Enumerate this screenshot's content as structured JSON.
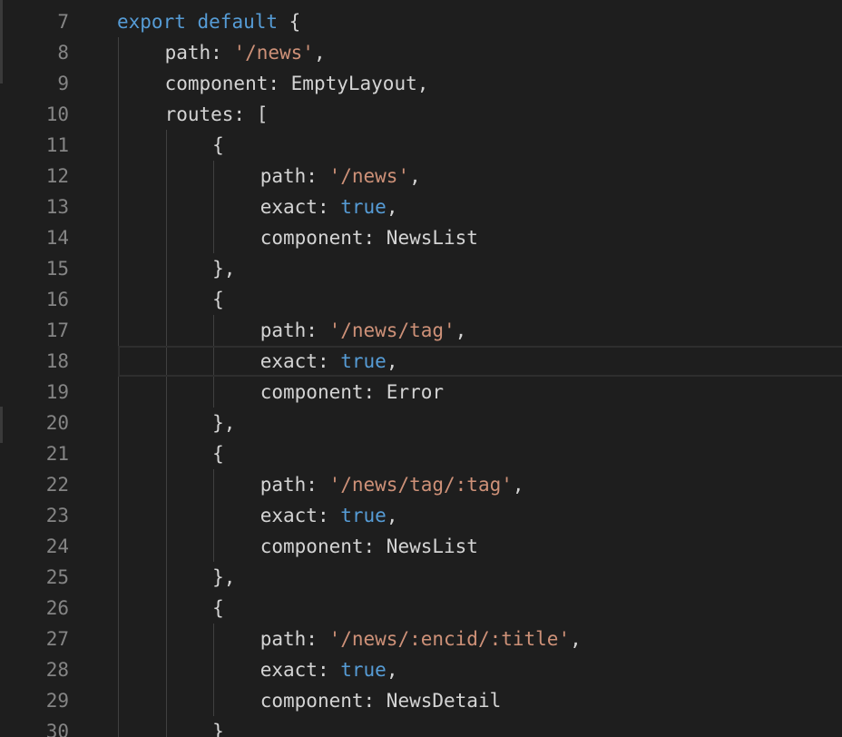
{
  "editor": {
    "colors": {
      "background": "#1e1e1e",
      "line_number": "#858585",
      "keyword": "#569cd6",
      "string": "#ce9178",
      "text": "#d4d4d4"
    },
    "current_line": "18",
    "lines": [
      {
        "n": "7",
        "indent": 0,
        "tokens": [
          {
            "t": "kw",
            "v": "export"
          },
          {
            "t": "plain",
            "v": " "
          },
          {
            "t": "kw",
            "v": "default"
          },
          {
            "t": "plain",
            "v": " {"
          }
        ]
      },
      {
        "n": "8",
        "indent": 1,
        "tokens": [
          {
            "t": "plain",
            "v": "path: "
          },
          {
            "t": "str",
            "v": "'/news'"
          },
          {
            "t": "plain",
            "v": ","
          }
        ]
      },
      {
        "n": "9",
        "indent": 1,
        "tokens": [
          {
            "t": "plain",
            "v": "component: EmptyLayout,"
          }
        ]
      },
      {
        "n": "10",
        "indent": 1,
        "tokens": [
          {
            "t": "plain",
            "v": "routes: ["
          }
        ]
      },
      {
        "n": "11",
        "indent": 2,
        "tokens": [
          {
            "t": "plain",
            "v": "{"
          }
        ]
      },
      {
        "n": "12",
        "indent": 3,
        "tokens": [
          {
            "t": "plain",
            "v": "path: "
          },
          {
            "t": "str",
            "v": "'/news'"
          },
          {
            "t": "plain",
            "v": ","
          }
        ]
      },
      {
        "n": "13",
        "indent": 3,
        "tokens": [
          {
            "t": "plain",
            "v": "exact: "
          },
          {
            "t": "bool",
            "v": "true"
          },
          {
            "t": "plain",
            "v": ","
          }
        ]
      },
      {
        "n": "14",
        "indent": 3,
        "tokens": [
          {
            "t": "plain",
            "v": "component: NewsList"
          }
        ]
      },
      {
        "n": "15",
        "indent": 2,
        "tokens": [
          {
            "t": "plain",
            "v": "},"
          }
        ]
      },
      {
        "n": "16",
        "indent": 2,
        "tokens": [
          {
            "t": "plain",
            "v": "{"
          }
        ]
      },
      {
        "n": "17",
        "indent": 3,
        "tokens": [
          {
            "t": "plain",
            "v": "path: "
          },
          {
            "t": "str",
            "v": "'/news/tag'"
          },
          {
            "t": "plain",
            "v": ","
          }
        ]
      },
      {
        "n": "18",
        "indent": 3,
        "tokens": [
          {
            "t": "plain",
            "v": "exact: "
          },
          {
            "t": "bool",
            "v": "true"
          },
          {
            "t": "plain",
            "v": ","
          }
        ]
      },
      {
        "n": "19",
        "indent": 3,
        "tokens": [
          {
            "t": "plain",
            "v": "component: Error"
          }
        ]
      },
      {
        "n": "20",
        "indent": 2,
        "tokens": [
          {
            "t": "plain",
            "v": "},"
          }
        ]
      },
      {
        "n": "21",
        "indent": 2,
        "tokens": [
          {
            "t": "plain",
            "v": "{"
          }
        ]
      },
      {
        "n": "22",
        "indent": 3,
        "tokens": [
          {
            "t": "plain",
            "v": "path: "
          },
          {
            "t": "str",
            "v": "'/news/tag/:tag'"
          },
          {
            "t": "plain",
            "v": ","
          }
        ]
      },
      {
        "n": "23",
        "indent": 3,
        "tokens": [
          {
            "t": "plain",
            "v": "exact: "
          },
          {
            "t": "bool",
            "v": "true"
          },
          {
            "t": "plain",
            "v": ","
          }
        ]
      },
      {
        "n": "24",
        "indent": 3,
        "tokens": [
          {
            "t": "plain",
            "v": "component: NewsList"
          }
        ]
      },
      {
        "n": "25",
        "indent": 2,
        "tokens": [
          {
            "t": "plain",
            "v": "},"
          }
        ]
      },
      {
        "n": "26",
        "indent": 2,
        "tokens": [
          {
            "t": "plain",
            "v": "{"
          }
        ]
      },
      {
        "n": "27",
        "indent": 3,
        "tokens": [
          {
            "t": "plain",
            "v": "path: "
          },
          {
            "t": "str",
            "v": "'/news/:encid/:title'"
          },
          {
            "t": "plain",
            "v": ","
          }
        ]
      },
      {
        "n": "28",
        "indent": 3,
        "tokens": [
          {
            "t": "plain",
            "v": "exact: "
          },
          {
            "t": "bool",
            "v": "true"
          },
          {
            "t": "plain",
            "v": ","
          }
        ]
      },
      {
        "n": "29",
        "indent": 3,
        "tokens": [
          {
            "t": "plain",
            "v": "component: NewsDetail"
          }
        ]
      },
      {
        "n": "30",
        "indent": 2,
        "tokens": [
          {
            "t": "plain",
            "v": "}"
          }
        ]
      }
    ]
  }
}
